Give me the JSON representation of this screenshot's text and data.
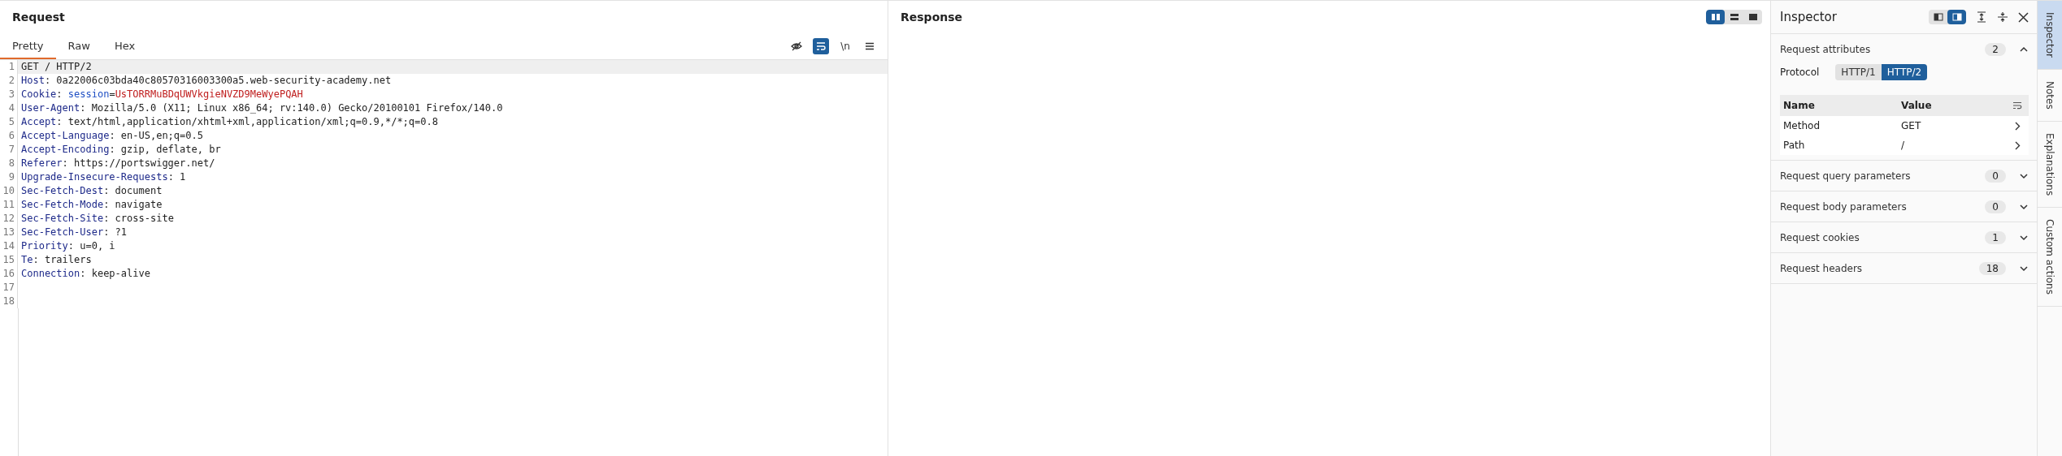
{
  "request": {
    "title": "Request",
    "tabs": [
      {
        "label": "Pretty",
        "selected": true
      },
      {
        "label": "Raw",
        "selected": false
      },
      {
        "label": "Hex",
        "selected": false
      }
    ],
    "toolbar": [
      {
        "kind": "eye-off",
        "selected": false
      },
      {
        "kind": "wrap",
        "selected": true
      },
      {
        "kind": "text",
        "label": "\\n",
        "selected": false
      },
      {
        "kind": "menu",
        "selected": false
      }
    ],
    "lines": [
      {
        "number": "1",
        "highlighted": true,
        "segments": [
          {
            "kind": "text",
            "text": "GET / HTTP/2"
          }
        ]
      },
      {
        "number": "2",
        "highlighted": false,
        "segments": [
          {
            "kind": "key",
            "text": "Host"
          },
          {
            "kind": "text",
            "text": ": 0a22006c03bda40c80570316003300a5.web-security-academy.net"
          }
        ]
      },
      {
        "number": "3",
        "highlighted": false,
        "segments": [
          {
            "kind": "key",
            "text": "Cookie"
          },
          {
            "kind": "text",
            "text": ": "
          },
          {
            "kind": "param",
            "text": "session"
          },
          {
            "kind": "text",
            "text": "="
          },
          {
            "kind": "value",
            "text": "UsTORRMuBDqUWVkgieNVZD9MeWyePQAH"
          }
        ]
      },
      {
        "number": "4",
        "highlighted": false,
        "segments": [
          {
            "kind": "key",
            "text": "User-Agent"
          },
          {
            "kind": "text",
            "text": ": Mozilla/5.0 (X11; Linux x86_64; rv:140.0) Gecko/20100101 Firefox/140.0"
          }
        ]
      },
      {
        "number": "5",
        "highlighted": false,
        "segments": [
          {
            "kind": "key",
            "text": "Accept"
          },
          {
            "kind": "text",
            "text": ": text/html,application/xhtml+xml,application/xml;q=0.9,*/*;q=0.8"
          }
        ]
      },
      {
        "number": "6",
        "highlighted": false,
        "segments": [
          {
            "kind": "key",
            "text": "Accept-Language"
          },
          {
            "kind": "text",
            "text": ": en-US,en;q=0.5"
          }
        ]
      },
      {
        "number": "7",
        "highlighted": false,
        "segments": [
          {
            "kind": "key",
            "text": "Accept-Encoding"
          },
          {
            "kind": "text",
            "text": ": gzip, deflate, br"
          }
        ]
      },
      {
        "number": "8",
        "highlighted": false,
        "segments": [
          {
            "kind": "key",
            "text": "Referer"
          },
          {
            "kind": "text",
            "text": ": https://portswigger.net/"
          }
        ]
      },
      {
        "number": "9",
        "highlighted": false,
        "segments": [
          {
            "kind": "key",
            "text": "Upgrade-Insecure-Requests"
          },
          {
            "kind": "text",
            "text": ": 1"
          }
        ]
      },
      {
        "number": "10",
        "highlighted": false,
        "segments": [
          {
            "kind": "key",
            "text": "Sec-Fetch-Dest"
          },
          {
            "kind": "text",
            "text": ": document"
          }
        ]
      },
      {
        "number": "11",
        "highlighted": false,
        "segments": [
          {
            "kind": "key",
            "text": "Sec-Fetch-Mode"
          },
          {
            "kind": "text",
            "text": ": navigate"
          }
        ]
      },
      {
        "number": "12",
        "highlighted": false,
        "segments": [
          {
            "kind": "key",
            "text": "Sec-Fetch-Site"
          },
          {
            "kind": "text",
            "text": ": cross-site"
          }
        ]
      },
      {
        "number": "13",
        "highlighted": false,
        "segments": [
          {
            "kind": "key",
            "text": "Sec-Fetch-User"
          },
          {
            "kind": "text",
            "text": ": ?1"
          }
        ]
      },
      {
        "number": "14",
        "highlighted": false,
        "segments": [
          {
            "kind": "key",
            "text": "Priority"
          },
          {
            "kind": "text",
            "text": ": u=0, i"
          }
        ]
      },
      {
        "number": "15",
        "highlighted": false,
        "segments": [
          {
            "kind": "key",
            "text": "Te"
          },
          {
            "kind": "text",
            "text": ": trailers"
          }
        ]
      },
      {
        "number": "16",
        "highlighted": false,
        "segments": [
          {
            "kind": "key",
            "text": "Connection"
          },
          {
            "kind": "text",
            "text": ": keep-alive"
          }
        ]
      },
      {
        "number": "17",
        "highlighted": false
      },
      {
        "number": "18",
        "highlighted": false
      }
    ]
  },
  "response": {
    "title": "Response",
    "layout_buttons": [
      {
        "kind": "columns",
        "selected": true
      },
      {
        "kind": "rows",
        "selected": false
      },
      {
        "kind": "single",
        "selected": false
      }
    ]
  },
  "inspector": {
    "title": "Inspector",
    "layout_buttons": [
      {
        "kind": "left",
        "selected": false
      },
      {
        "kind": "right",
        "selected": true
      }
    ],
    "sections": [
      {
        "title": "Request attributes",
        "count": "2",
        "expanded": true,
        "protocol": {
          "label": "Protocol",
          "options": [
            {
              "label": "HTTP/1",
              "selected": false
            },
            {
              "label": "HTTP/2",
              "selected": true
            }
          ]
        },
        "table": {
          "columns": [
            "Name",
            "Value"
          ],
          "rows": [
            {
              "name": "Method",
              "value": "GET"
            },
            {
              "name": "Path",
              "value": "/"
            }
          ]
        }
      },
      {
        "title": "Request query parameters",
        "count": "0",
        "expanded": false
      },
      {
        "title": "Request body parameters",
        "count": "0",
        "expanded": false
      },
      {
        "title": "Request cookies",
        "count": "1",
        "expanded": false
      },
      {
        "title": "Request headers",
        "count": "18",
        "expanded": false
      }
    ]
  },
  "side_tabs": [
    {
      "label": "Inspector",
      "selected": true
    },
    {
      "label": "Notes",
      "selected": false
    },
    {
      "label": "Explanations",
      "selected": false
    },
    {
      "label": "Custom actions",
      "selected": false
    }
  ]
}
